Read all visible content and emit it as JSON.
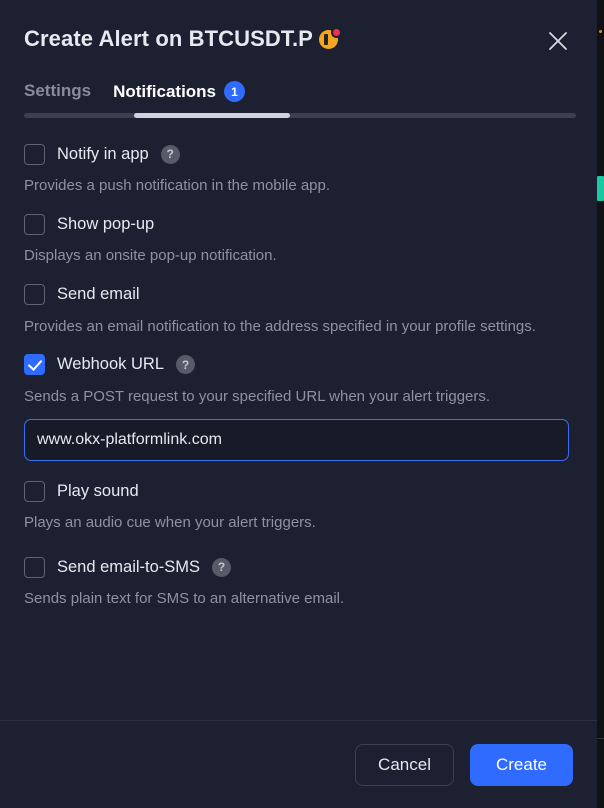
{
  "dialog": {
    "title": "Create Alert on BTCUSDT.P",
    "symbol_icon": "bitcoin-coin-icon",
    "symbol_badge": "red-dot-badge",
    "close_icon": "close-icon",
    "accent_color": "#2f6bff",
    "background_color": "#1c2030"
  },
  "tabs": {
    "items": [
      {
        "label": "Settings",
        "active": false,
        "badge": null
      },
      {
        "label": "Notifications",
        "active": true,
        "badge": "1"
      }
    ]
  },
  "options": [
    {
      "label": "Notify in app",
      "checked": false,
      "has_help": true,
      "description": "Provides a push notification in the mobile app."
    },
    {
      "label": "Show pop-up",
      "checked": false,
      "has_help": false,
      "description": "Displays an onsite pop-up notification."
    },
    {
      "label": "Send email",
      "checked": false,
      "has_help": false,
      "description": "Provides an email notification to the address specified in your profile settings."
    },
    {
      "label": "Webhook URL",
      "checked": true,
      "has_help": true,
      "description": "Sends a POST request to your specified URL when your alert triggers.",
      "input": {
        "value": "www.okx-platformlink.com",
        "placeholder": "https://"
      }
    },
    {
      "label": "Play sound",
      "checked": false,
      "has_help": false,
      "description": "Plays an audio cue when your alert triggers."
    },
    {
      "label": "Send email-to-SMS",
      "checked": false,
      "has_help": true,
      "description": "Sends plain text for SMS to an alternative email."
    }
  ],
  "footer": {
    "cancel_label": "Cancel",
    "create_label": "Create"
  },
  "help_glyph": "?"
}
